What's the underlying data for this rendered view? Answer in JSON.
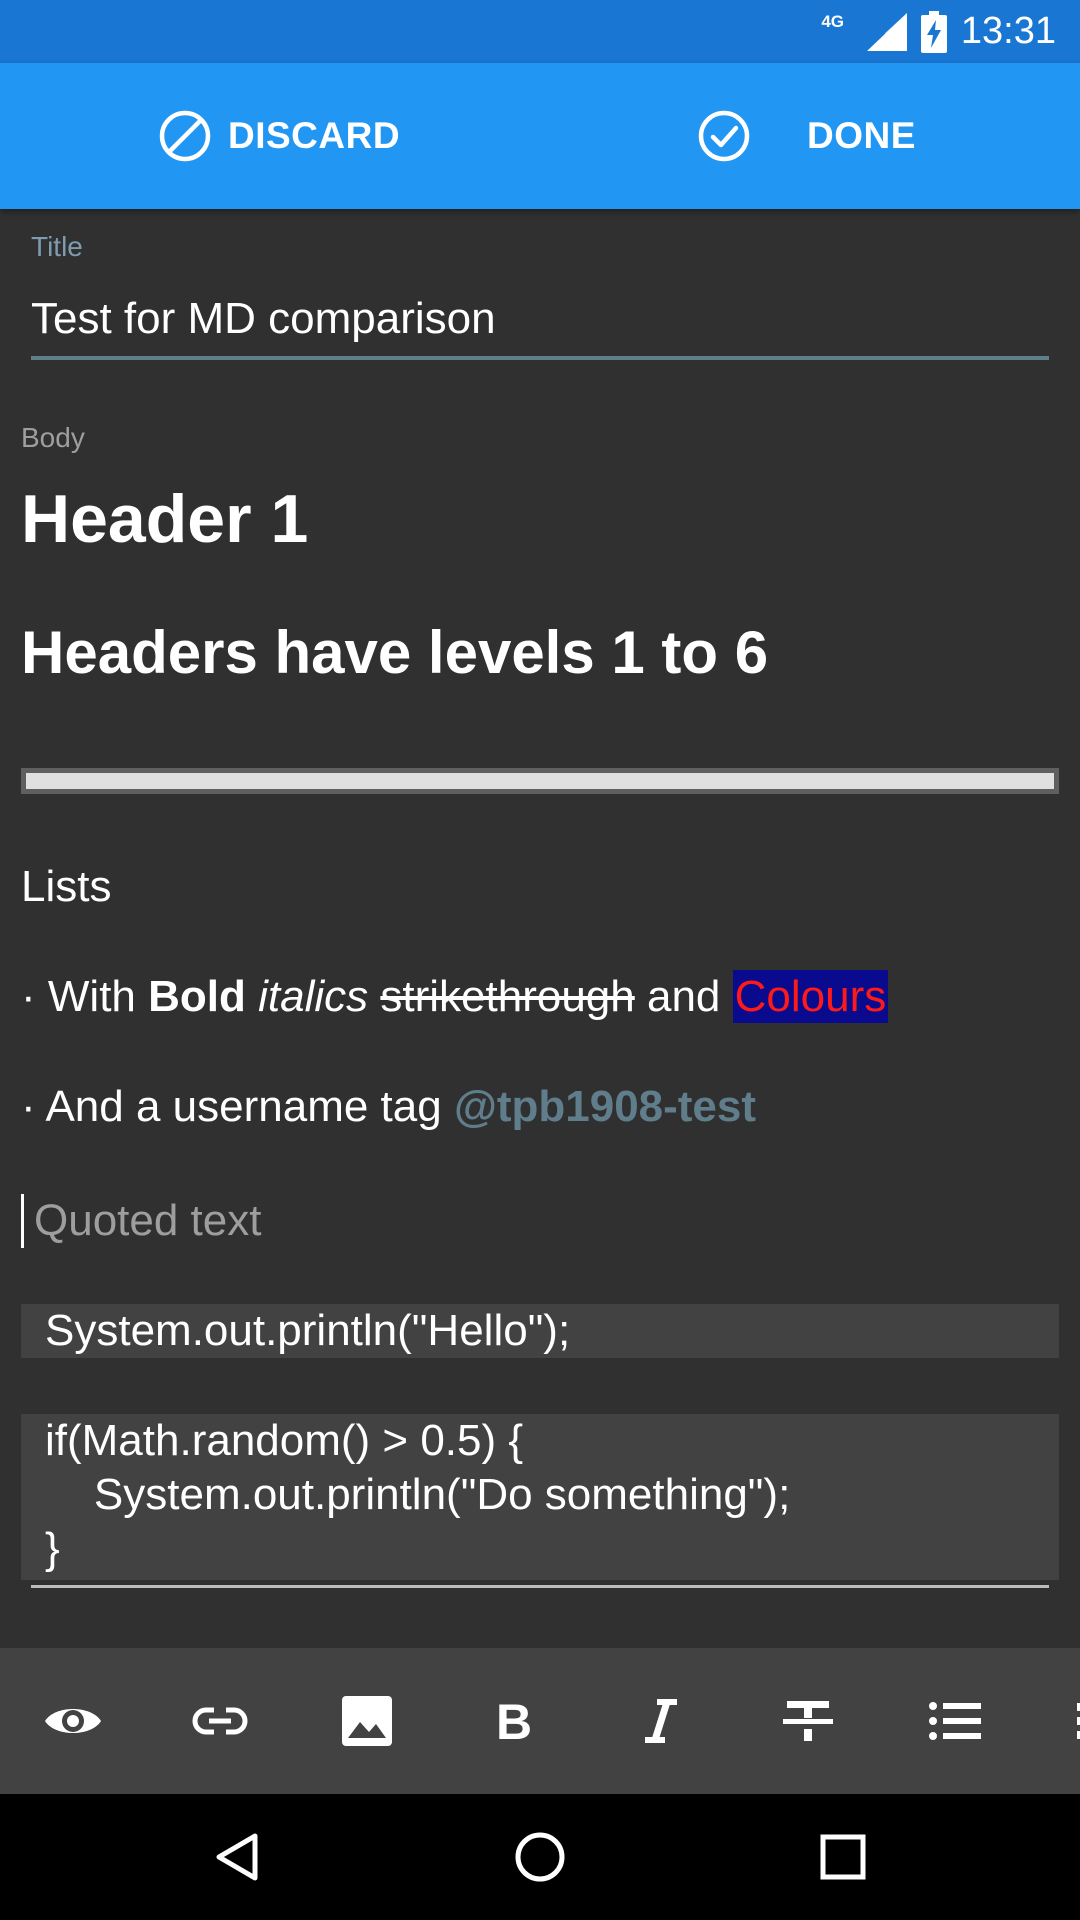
{
  "status_bar": {
    "network": "4G",
    "time": "13:31"
  },
  "action_bar": {
    "discard_label": "DISCARD",
    "done_label": "DONE"
  },
  "title_field": {
    "label": "Title",
    "value": "Test for MD comparison"
  },
  "body_field": {
    "label": "Body",
    "header1": "Header 1",
    "header2": "Headers have levels 1 to 6",
    "lists_heading": "Lists",
    "bullet1": {
      "bullet": "· ",
      "prefix": "With ",
      "bold": "Bold",
      "italic": "italics",
      "strike": "strikethrough",
      "connector": " and ",
      "colour": "Colours"
    },
    "bullet2": {
      "bullet": "· ",
      "prefix": "And a username tag ",
      "mention": "@tpb1908-test"
    },
    "quote": "Quoted text",
    "code_inline": "System.out.println(\"Hello\");",
    "code_block": "if(Math.random() > 0.5) {\n    System.out.println(\"Do something\");\n}"
  },
  "colors": {
    "status_bar": "#1976d2",
    "action_bar": "#2196f3",
    "background": "#303030",
    "toolbar": "#424242",
    "mention": "#607d8b",
    "colour_text": "#ff1a1a",
    "colour_bg": "#0a0a8f"
  },
  "toolbar_icons": [
    "eye-icon",
    "link-icon",
    "image-icon",
    "bold-icon",
    "italic-icon",
    "strikethrough-icon",
    "bulleted-list-icon",
    "numbered-list-icon"
  ],
  "nav_icons": [
    "back-icon",
    "home-icon",
    "recents-icon"
  ]
}
